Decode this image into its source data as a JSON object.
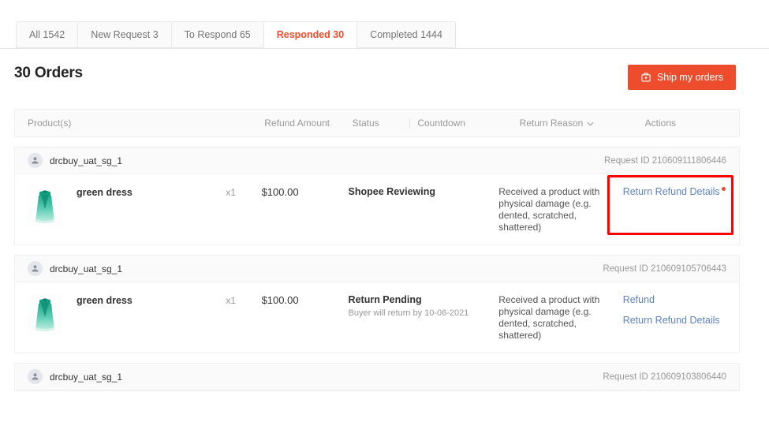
{
  "tabs": [
    {
      "label": "All 1542",
      "active": false
    },
    {
      "label": "New Request 3",
      "active": false
    },
    {
      "label": "To Respond 65",
      "active": false
    },
    {
      "label": "Responded 30",
      "active": true
    },
    {
      "label": "Completed 1444",
      "active": false
    }
  ],
  "header": {
    "title": "30 Orders",
    "ship_button": "Ship my orders",
    "ship_button_icon": "shipping-box-icon",
    "accent_color": "#ee4d2d"
  },
  "table": {
    "columns": {
      "product": "Product(s)",
      "refund_amount": "Refund Amount",
      "status": "Status",
      "countdown": "Countdown",
      "return_reason": "Return Reason",
      "return_reason_icon": "chevron-down-icon",
      "actions": "Actions"
    }
  },
  "orders": [
    {
      "buyer": "drcbuy_uat_sg_1",
      "buyer_icon": "user-avatar-icon",
      "request_id": "Request ID 210609111806446",
      "product": {
        "name": "green dress",
        "image": "green-dress-thumbnail",
        "quantity": "x1",
        "refund_amount": "$100.00"
      },
      "status_main": "Shopee Reviewing",
      "status_sub": "",
      "return_reason": "Received a product with physical damage (e.g. dented, scratched, shattered)",
      "actions": [
        {
          "label": "Return Refund Details",
          "badge": true
        }
      ],
      "highlighted": true
    },
    {
      "buyer": "drcbuy_uat_sg_1",
      "buyer_icon": "user-avatar-icon",
      "request_id": "Request ID 210609105706443",
      "product": {
        "name": "green dress",
        "image": "green-dress-thumbnail",
        "quantity": "x1",
        "refund_amount": "$100.00"
      },
      "status_main": "Return Pending",
      "status_sub": "Buyer will return by 10-06-2021",
      "return_reason": "Received a product with physical damage (e.g. dented, scratched, shattered)",
      "actions": [
        {
          "label": "Refund",
          "badge": false
        },
        {
          "label": "Return Refund Details",
          "badge": false
        }
      ],
      "highlighted": false
    },
    {
      "buyer": "drcbuy_uat_sg_1",
      "buyer_icon": "user-avatar-icon",
      "request_id": "Request ID 210609103806440",
      "product": null,
      "status_main": "",
      "status_sub": "",
      "return_reason": "",
      "actions": [],
      "highlighted": false
    }
  ]
}
